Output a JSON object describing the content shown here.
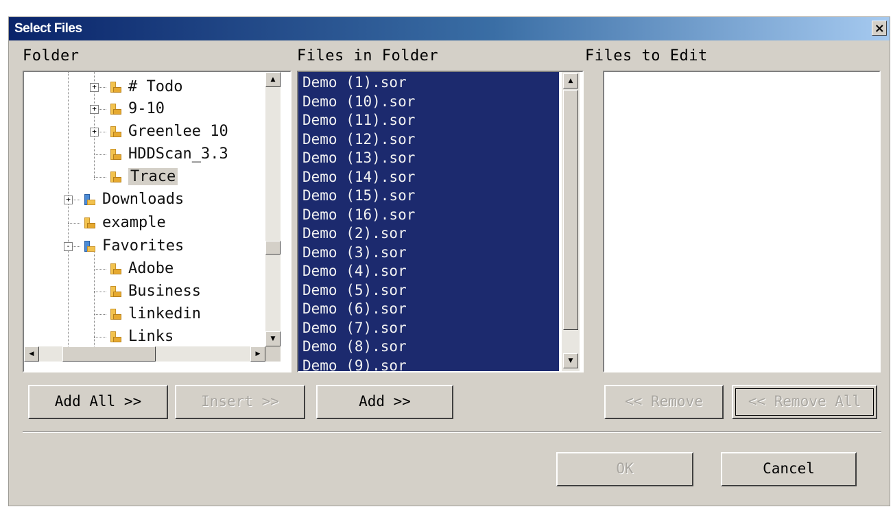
{
  "window": {
    "title": "Select Files",
    "close_glyph": "×"
  },
  "labels": {
    "folder": "Folder",
    "files_in_folder": "Files in Folder",
    "files_to_edit": "Files to Edit"
  },
  "folder_tree": {
    "items": [
      {
        "label": "# Todo",
        "expander": "+",
        "icon": "folder-icon"
      },
      {
        "label": "9-10",
        "expander": "+",
        "icon": "folder-icon"
      },
      {
        "label": "Greenlee 10",
        "expander": "+",
        "icon": "folder-icon"
      },
      {
        "label": "HDDScan_3.3",
        "expander": "",
        "icon": "folder-icon"
      },
      {
        "label": "Trace",
        "expander": "",
        "icon": "folder-icon",
        "selected": true
      },
      {
        "label": "Downloads",
        "expander": "+",
        "icon": "downloads-folder-icon"
      },
      {
        "label": "example",
        "expander": "",
        "icon": "folder-icon"
      },
      {
        "label": "Favorites",
        "expander": "-",
        "icon": "favorites-folder-icon"
      },
      {
        "label": "Adobe",
        "expander": "",
        "icon": "folder-icon"
      },
      {
        "label": "Business",
        "expander": "",
        "icon": "folder-icon"
      },
      {
        "label": "linkedin",
        "expander": "",
        "icon": "folder-icon"
      },
      {
        "label": "Links",
        "expander": "",
        "icon": "folder-icon"
      }
    ]
  },
  "files_in_folder": {
    "items": [
      "Demo (1).sor",
      "Demo (10).sor",
      "Demo (11).sor",
      "Demo (12).sor",
      "Demo (13).sor",
      "Demo (14).sor",
      "Demo (15).sor",
      "Demo (16).sor",
      "Demo (2).sor",
      "Demo (3).sor",
      "Demo (4).sor",
      "Demo (5).sor",
      "Demo (6).sor",
      "Demo (7).sor",
      "Demo (8).sor",
      "Demo (9).sor"
    ],
    "selection_color": "#1c2a6e"
  },
  "files_to_edit": {
    "items": []
  },
  "buttons": {
    "add_all": "Add All >>",
    "insert": "Insert >>",
    "add": "Add >>",
    "remove": "<< Remove",
    "remove_all": "<< Remove All",
    "ok": "OK",
    "cancel": "Cancel"
  },
  "scroll_glyphs": {
    "up": "▲",
    "down": "▼",
    "left": "◀",
    "right": "▶"
  },
  "colors": {
    "title_gradient_start": "#0a246a",
    "title_gradient_end": "#a6caf0",
    "dialog_face": "#d4d0c8"
  }
}
